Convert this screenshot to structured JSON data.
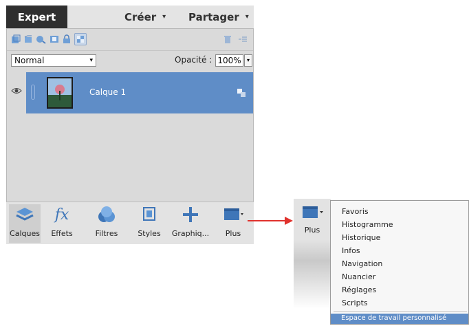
{
  "tabs": {
    "expert": "Expert",
    "creer": "Créer",
    "partager": "Partager",
    "dropdown_caret": "▾"
  },
  "blend_mode": "Normal",
  "opacity": {
    "label": "Opacité :",
    "value": "100%"
  },
  "layer": {
    "name": "Calque 1"
  },
  "bottom": [
    {
      "label": "Calques",
      "icon": "layers-icon"
    },
    {
      "label": "Effets",
      "icon": "fx-icon"
    },
    {
      "label": "Filtres",
      "icon": "filters-icon"
    },
    {
      "label": "Styles",
      "icon": "styles-icon"
    },
    {
      "label": "Graphiq...",
      "icon": "plus-icon"
    },
    {
      "label": "Plus",
      "icon": "panel-icon"
    }
  ],
  "flyout": {
    "plus_label": "Plus",
    "items": [
      "Favoris",
      "Histogramme",
      "Historique",
      "Infos",
      "Navigation",
      "Nuancier",
      "Réglages",
      "Scripts"
    ],
    "highlighted": "Espace de travail personnalisé"
  },
  "colors": {
    "accent": "#5f8dc7",
    "arrow": "#e0322d",
    "dark_tab": "#2f2f2f"
  }
}
